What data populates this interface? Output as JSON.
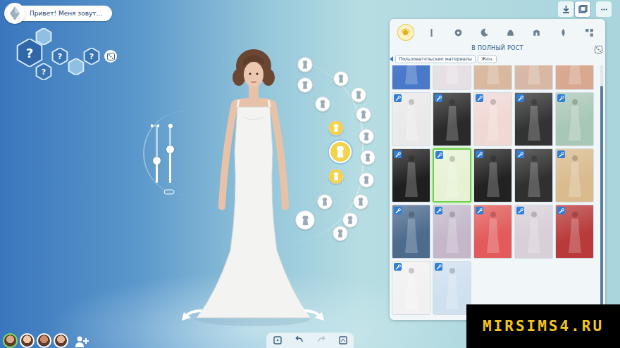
{
  "name_bubble": {
    "text": "Привет! Меня зовут..."
  },
  "traits": [
    {
      "label": "?",
      "kind": "large"
    },
    {
      "label": "?",
      "kind": "small"
    },
    {
      "label": "?",
      "kind": "small"
    },
    {
      "label": "?",
      "kind": "small"
    }
  ],
  "body_sliders": [
    {
      "level": 0.4
    },
    {
      "level": 0.6
    }
  ],
  "category_wheel": [
    {
      "selected": false,
      "equipped": false
    },
    {
      "selected": false,
      "equipped": false
    },
    {
      "selected": false,
      "equipped": true
    },
    {
      "selected": true,
      "equipped": true
    },
    {
      "selected": false,
      "equipped": true
    },
    {
      "selected": false,
      "equipped": false
    },
    {
      "selected": false,
      "equipped": false
    },
    {
      "selected": false,
      "equipped": false
    },
    {
      "selected": false,
      "equipped": false
    },
    {
      "selected": false,
      "equipped": false
    },
    {
      "selected": false,
      "equipped": false
    },
    {
      "selected": false,
      "equipped": false
    },
    {
      "selected": false,
      "equipped": false
    },
    {
      "selected": false,
      "equipped": false
    },
    {
      "selected": false,
      "equipped": false
    },
    {
      "selected": false,
      "equipped": false
    },
    {
      "selected": false,
      "equipped": false
    }
  ],
  "panel": {
    "tabs": [
      {
        "selected": true
      },
      {
        "selected": false
      },
      {
        "selected": false
      },
      {
        "selected": false
      },
      {
        "selected": false
      },
      {
        "selected": false
      },
      {
        "selected": false
      },
      {
        "selected": false
      }
    ],
    "title": "В ПОЛНЫЙ РОСТ",
    "filters": [
      {
        "label": "Пользовательские материалы"
      },
      {
        "label": "Жен."
      }
    ],
    "items": [
      {
        "selected": false,
        "custom": false,
        "color": "#4a79c9"
      },
      {
        "selected": false,
        "custom": false,
        "color": "#e6e0e4"
      },
      {
        "selected": false,
        "custom": false,
        "color": "#d9b8a0"
      },
      {
        "selected": false,
        "custom": false,
        "color": "#d8b8a4"
      },
      {
        "selected": false,
        "custom": false,
        "color": "#d9a890"
      },
      {
        "selected": false,
        "custom": true,
        "color": "#e9e9ea"
      },
      {
        "selected": false,
        "custom": true,
        "color": "#2a2a2a"
      },
      {
        "selected": false,
        "custom": true,
        "color": "#f0d8d4"
      },
      {
        "selected": false,
        "custom": true,
        "color": "#333333"
      },
      {
        "selected": false,
        "custom": true,
        "color": "#a9c7b5"
      },
      {
        "selected": false,
        "custom": true,
        "color": "#1f1f1f"
      },
      {
        "selected": true,
        "custom": true,
        "color": "#e6f2d5"
      },
      {
        "selected": false,
        "custom": true,
        "color": "#222222"
      },
      {
        "selected": false,
        "custom": true,
        "color": "#303030"
      },
      {
        "selected": false,
        "custom": true,
        "color": "#d9bb8e"
      },
      {
        "selected": false,
        "custom": true,
        "color": "#4d6b8d"
      },
      {
        "selected": false,
        "custom": true,
        "color": "#c3b7c9"
      },
      {
        "selected": false,
        "custom": true,
        "color": "#e25a5a"
      },
      {
        "selected": false,
        "custom": true,
        "color": "#d8cfd8"
      },
      {
        "selected": false,
        "custom": true,
        "color": "#b83a3a"
      },
      {
        "selected": false,
        "custom": true,
        "color": "#f1f1f1"
      },
      {
        "selected": false,
        "custom": true,
        "color": "#cfe0ef"
      }
    ],
    "scrollbar": {
      "level": 0.92
    }
  },
  "top_buttons": [
    {
      "selected": false
    },
    {
      "selected": true
    },
    {
      "selected": false
    }
  ],
  "household": [
    {
      "selected": true
    },
    {
      "selected": false
    },
    {
      "selected": false
    },
    {
      "selected": false
    }
  ],
  "toolbar": [
    {
      "disabled": false
    },
    {
      "disabled": false
    },
    {
      "disabled": true
    },
    {
      "disabled": false
    }
  ],
  "watermark": {
    "text": "MIRSIMS4.RU"
  }
}
